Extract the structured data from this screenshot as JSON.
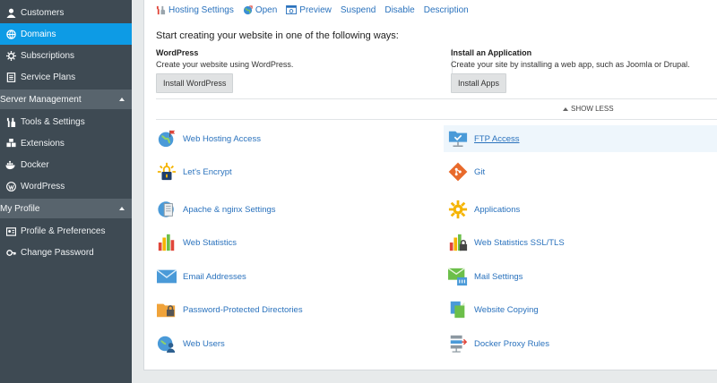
{
  "sidebar": {
    "items": [
      {
        "label": "Customers",
        "icon": "user-icon"
      },
      {
        "label": "Domains",
        "icon": "globe-icon",
        "active": true
      },
      {
        "label": "Subscriptions",
        "icon": "subscriptions-icon"
      },
      {
        "label": "Service Plans",
        "icon": "service-plans-icon"
      }
    ],
    "sections": [
      {
        "label": "Server Management",
        "items": [
          {
            "label": "Tools & Settings",
            "icon": "tools-icon"
          },
          {
            "label": "Extensions",
            "icon": "extensions-icon"
          },
          {
            "label": "Docker",
            "icon": "docker-icon"
          },
          {
            "label": "WordPress",
            "icon": "wordpress-icon"
          }
        ]
      },
      {
        "label": "My Profile",
        "items": [
          {
            "label": "Profile & Preferences",
            "icon": "profile-icon"
          },
          {
            "label": "Change Password",
            "icon": "key-icon"
          }
        ]
      }
    ]
  },
  "toolbar": {
    "hosting_settings": "Hosting Settings",
    "open": "Open",
    "preview": "Preview",
    "suspend": "Suspend",
    "disable": "Disable",
    "description": "Description"
  },
  "create": {
    "title": "Start creating your website in one of the following ways:",
    "wordpress": {
      "title": "WordPress",
      "desc": "Create your website using WordPress.",
      "button": "Install WordPress"
    },
    "app": {
      "title": "Install an Application",
      "desc": "Create your site by installing a web app, such as Joomla or Drupal.",
      "button": "Install Apps"
    },
    "show_less": "SHOW LESS"
  },
  "tools": {
    "left": [
      {
        "label": "Web Hosting Access",
        "icon": "web-hosting-access-icon"
      },
      {
        "label": "Let's Encrypt",
        "icon": "lets-encrypt-icon"
      },
      {
        "label": "Apache & nginx Settings",
        "icon": "apache-nginx-icon"
      },
      {
        "label": "Web Statistics",
        "icon": "web-statistics-icon"
      },
      {
        "label": "Email Addresses",
        "icon": "email-icon"
      },
      {
        "label": "Password-Protected Directories",
        "icon": "folder-lock-icon"
      },
      {
        "label": "Web Users",
        "icon": "web-users-icon"
      }
    ],
    "right": [
      {
        "label": "FTP Access",
        "icon": "ftp-icon"
      },
      {
        "label": "Git",
        "icon": "git-icon"
      },
      {
        "label": "Applications",
        "icon": "applications-icon"
      },
      {
        "label": "Web Statistics SSL/TLS",
        "icon": "web-statistics-ssl-icon"
      },
      {
        "label": "Mail Settings",
        "icon": "mail-settings-icon"
      },
      {
        "label": "Website Copying",
        "icon": "website-copying-icon"
      },
      {
        "label": "Docker Proxy Rules",
        "icon": "docker-proxy-icon"
      }
    ]
  },
  "colors": {
    "sidebar_bg": "#3e4a53",
    "active": "#0d9be5",
    "link": "#2a72bd"
  }
}
